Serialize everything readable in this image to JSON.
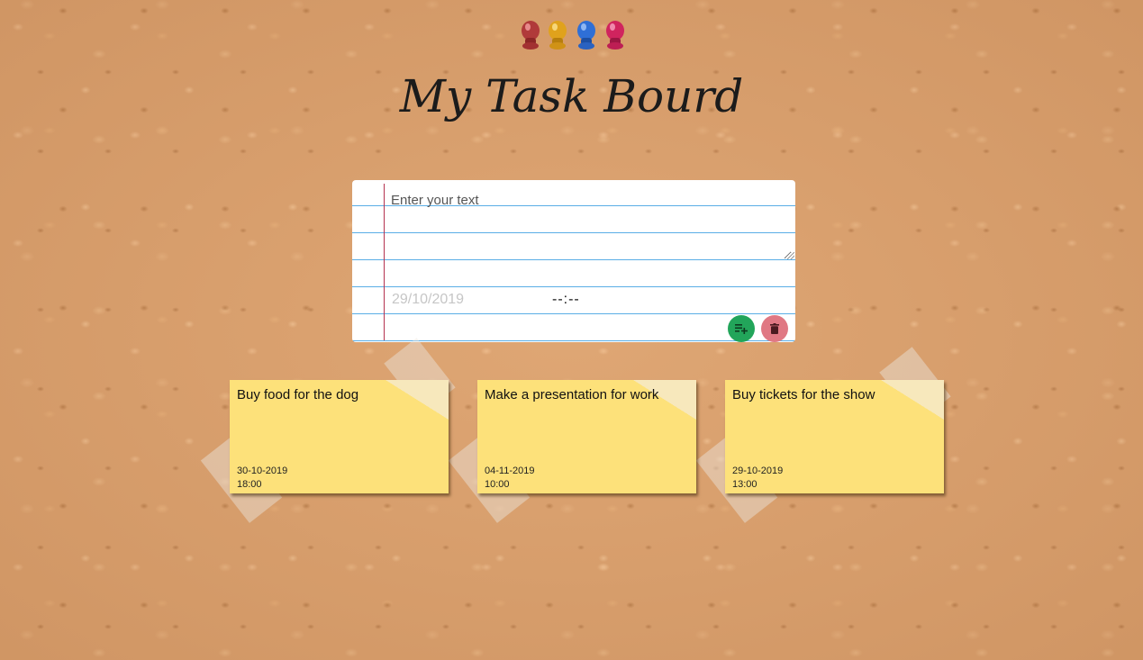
{
  "app": {
    "title": "My Task Bourd"
  },
  "pins": {
    "colors": [
      "#b03a3a",
      "#e0a21c",
      "#2f6fd6",
      "#d0245e"
    ],
    "icon": "push-pin-icon"
  },
  "form": {
    "text_placeholder": "Enter your text",
    "text_value": "",
    "date_value": "29/10/2019",
    "time_value": "--:--",
    "add_icon": "playlist-add-icon",
    "clear_icon": "trash-icon",
    "add_color": "#22a55a",
    "clear_color": "#e07883",
    "line_color": "#5aaee6",
    "margin_color": "#b5324f"
  },
  "tasks": [
    {
      "text": "Buy food for the dog",
      "date": "30-10-2019",
      "time": "18:00"
    },
    {
      "text": "Make a presentation for work",
      "date": "04-11-2019",
      "time": "10:00"
    },
    {
      "text": "Buy tickets for the show",
      "date": "29-10-2019",
      "time": "13:00"
    }
  ],
  "colors": {
    "board": "#dca26f",
    "note": "#fde17a"
  }
}
